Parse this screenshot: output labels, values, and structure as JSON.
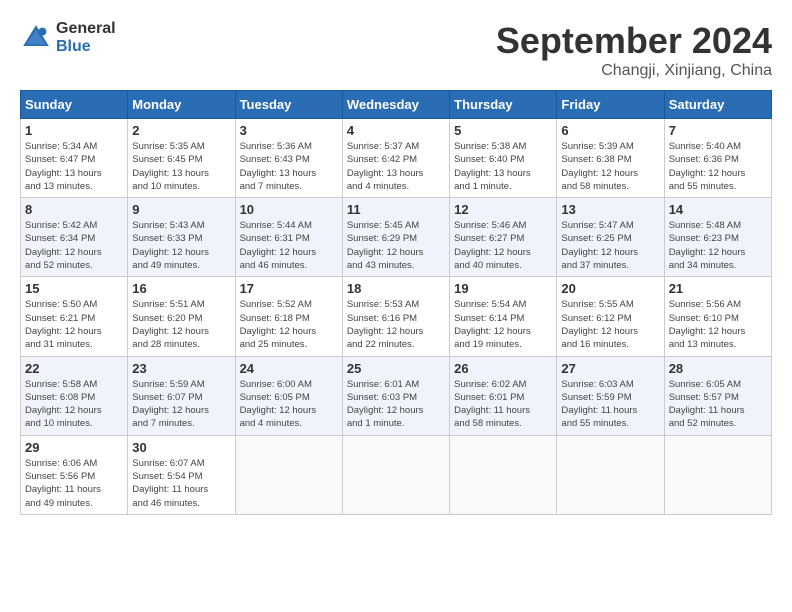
{
  "header": {
    "logo_general": "General",
    "logo_blue": "Blue",
    "month_title": "September 2024",
    "location": "Changji, Xinjiang, China"
  },
  "weekdays": [
    "Sunday",
    "Monday",
    "Tuesday",
    "Wednesday",
    "Thursday",
    "Friday",
    "Saturday"
  ],
  "weeks": [
    [
      {
        "day": "1",
        "info": "Sunrise: 5:34 AM\nSunset: 6:47 PM\nDaylight: 13 hours\nand 13 minutes."
      },
      {
        "day": "2",
        "info": "Sunrise: 5:35 AM\nSunset: 6:45 PM\nDaylight: 13 hours\nand 10 minutes."
      },
      {
        "day": "3",
        "info": "Sunrise: 5:36 AM\nSunset: 6:43 PM\nDaylight: 13 hours\nand 7 minutes."
      },
      {
        "day": "4",
        "info": "Sunrise: 5:37 AM\nSunset: 6:42 PM\nDaylight: 13 hours\nand 4 minutes."
      },
      {
        "day": "5",
        "info": "Sunrise: 5:38 AM\nSunset: 6:40 PM\nDaylight: 13 hours\nand 1 minute."
      },
      {
        "day": "6",
        "info": "Sunrise: 5:39 AM\nSunset: 6:38 PM\nDaylight: 12 hours\nand 58 minutes."
      },
      {
        "day": "7",
        "info": "Sunrise: 5:40 AM\nSunset: 6:36 PM\nDaylight: 12 hours\nand 55 minutes."
      }
    ],
    [
      {
        "day": "8",
        "info": "Sunrise: 5:42 AM\nSunset: 6:34 PM\nDaylight: 12 hours\nand 52 minutes."
      },
      {
        "day": "9",
        "info": "Sunrise: 5:43 AM\nSunset: 6:33 PM\nDaylight: 12 hours\nand 49 minutes."
      },
      {
        "day": "10",
        "info": "Sunrise: 5:44 AM\nSunset: 6:31 PM\nDaylight: 12 hours\nand 46 minutes."
      },
      {
        "day": "11",
        "info": "Sunrise: 5:45 AM\nSunset: 6:29 PM\nDaylight: 12 hours\nand 43 minutes."
      },
      {
        "day": "12",
        "info": "Sunrise: 5:46 AM\nSunset: 6:27 PM\nDaylight: 12 hours\nand 40 minutes."
      },
      {
        "day": "13",
        "info": "Sunrise: 5:47 AM\nSunset: 6:25 PM\nDaylight: 12 hours\nand 37 minutes."
      },
      {
        "day": "14",
        "info": "Sunrise: 5:48 AM\nSunset: 6:23 PM\nDaylight: 12 hours\nand 34 minutes."
      }
    ],
    [
      {
        "day": "15",
        "info": "Sunrise: 5:50 AM\nSunset: 6:21 PM\nDaylight: 12 hours\nand 31 minutes."
      },
      {
        "day": "16",
        "info": "Sunrise: 5:51 AM\nSunset: 6:20 PM\nDaylight: 12 hours\nand 28 minutes."
      },
      {
        "day": "17",
        "info": "Sunrise: 5:52 AM\nSunset: 6:18 PM\nDaylight: 12 hours\nand 25 minutes."
      },
      {
        "day": "18",
        "info": "Sunrise: 5:53 AM\nSunset: 6:16 PM\nDaylight: 12 hours\nand 22 minutes."
      },
      {
        "day": "19",
        "info": "Sunrise: 5:54 AM\nSunset: 6:14 PM\nDaylight: 12 hours\nand 19 minutes."
      },
      {
        "day": "20",
        "info": "Sunrise: 5:55 AM\nSunset: 6:12 PM\nDaylight: 12 hours\nand 16 minutes."
      },
      {
        "day": "21",
        "info": "Sunrise: 5:56 AM\nSunset: 6:10 PM\nDaylight: 12 hours\nand 13 minutes."
      }
    ],
    [
      {
        "day": "22",
        "info": "Sunrise: 5:58 AM\nSunset: 6:08 PM\nDaylight: 12 hours\nand 10 minutes."
      },
      {
        "day": "23",
        "info": "Sunrise: 5:59 AM\nSunset: 6:07 PM\nDaylight: 12 hours\nand 7 minutes."
      },
      {
        "day": "24",
        "info": "Sunrise: 6:00 AM\nSunset: 6:05 PM\nDaylight: 12 hours\nand 4 minutes."
      },
      {
        "day": "25",
        "info": "Sunrise: 6:01 AM\nSunset: 6:03 PM\nDaylight: 12 hours\nand 1 minute."
      },
      {
        "day": "26",
        "info": "Sunrise: 6:02 AM\nSunset: 6:01 PM\nDaylight: 11 hours\nand 58 minutes."
      },
      {
        "day": "27",
        "info": "Sunrise: 6:03 AM\nSunset: 5:59 PM\nDaylight: 11 hours\nand 55 minutes."
      },
      {
        "day": "28",
        "info": "Sunrise: 6:05 AM\nSunset: 5:57 PM\nDaylight: 11 hours\nand 52 minutes."
      }
    ],
    [
      {
        "day": "29",
        "info": "Sunrise: 6:06 AM\nSunset: 5:56 PM\nDaylight: 11 hours\nand 49 minutes."
      },
      {
        "day": "30",
        "info": "Sunrise: 6:07 AM\nSunset: 5:54 PM\nDaylight: 11 hours\nand 46 minutes."
      },
      {
        "day": "",
        "info": ""
      },
      {
        "day": "",
        "info": ""
      },
      {
        "day": "",
        "info": ""
      },
      {
        "day": "",
        "info": ""
      },
      {
        "day": "",
        "info": ""
      }
    ]
  ]
}
